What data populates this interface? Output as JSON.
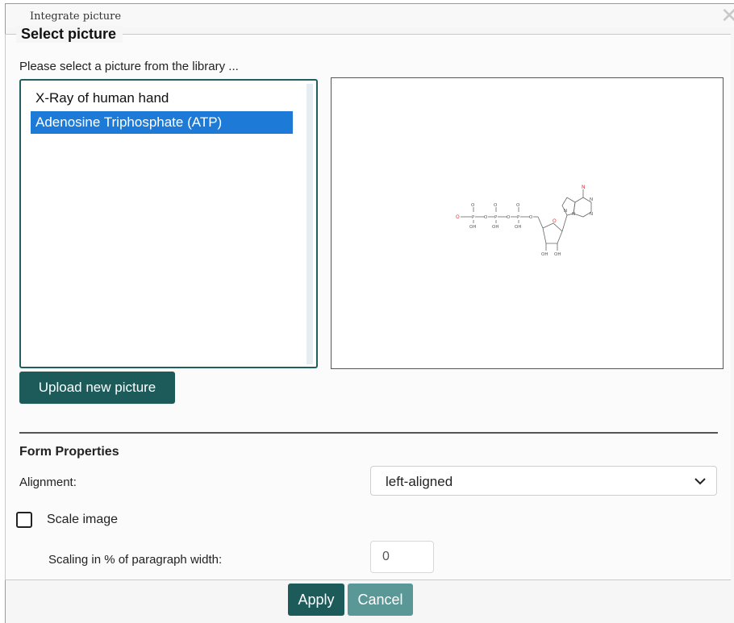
{
  "dialog": {
    "title": "Integrate picture",
    "close_icon": "close-icon"
  },
  "select_picture": {
    "legend": "Select picture",
    "instruction": "Please select a picture from the library ...",
    "items": [
      {
        "label": "X-Ray of human hand",
        "selected": false
      },
      {
        "label": "Adenosine Triphosphate (ATP)",
        "selected": true
      }
    ],
    "upload_button": "Upload new picture"
  },
  "form_properties": {
    "title": "Form Properties",
    "alignment_label": "Alignment:",
    "alignment_value": "left-aligned",
    "scale_label": "Scale image",
    "scale_checked": false,
    "scaling_label": "Scaling in % of paragraph width:",
    "scaling_value": "0"
  },
  "buttons": {
    "apply": "Apply",
    "cancel": "Cancel"
  },
  "colors": {
    "primary": "#1d5a5a",
    "secondary": "#5a9898",
    "selection": "#1d7bd7"
  }
}
